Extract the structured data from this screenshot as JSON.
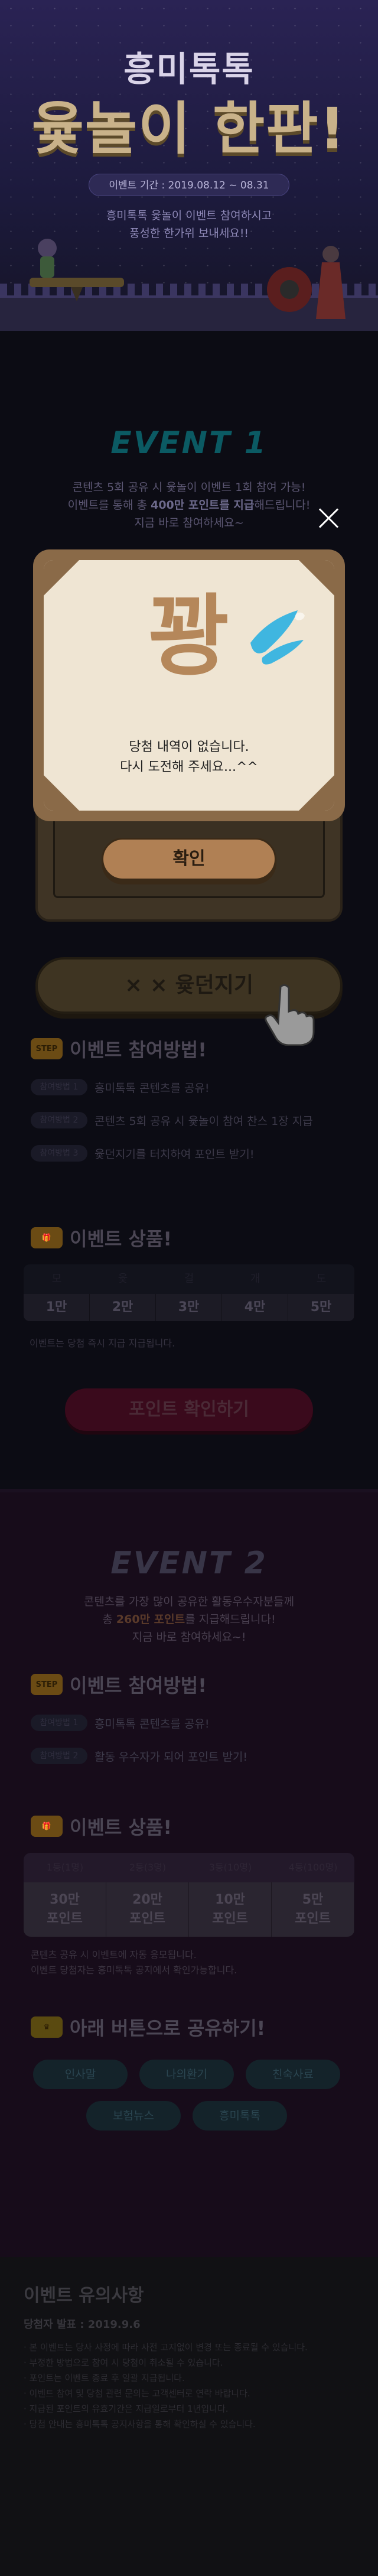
{
  "hero": {
    "title_line1": "흥미톡톡",
    "title_line2": "윷놀이 한판!",
    "period": "이벤트 기간 : 2019.08.12 ~ 08.31",
    "desc_line1": "흥미톡톡 윷놀이 이벤트 참여하시고",
    "desc_line2": "풍성한 한가위 보내세요!!"
  },
  "event1": {
    "label": "EVENT 1",
    "desc_line1": "콘텐츠 5회 공유 시 윷놀이 이벤트 1회 참여 가능!",
    "desc_line2_pre": "이벤트를 통해 총 ",
    "desc_line2_hl": "400만 포인트를 지급",
    "desc_line2_post": "해드립니다!",
    "desc_line3": "지금 바로 참여하세요~",
    "throw_button": "윷던지기",
    "throw_marks": "× ×",
    "method_title": "이벤트 참여방법!",
    "method_icon": "STEP",
    "steps": [
      {
        "badge": "참여방법 1",
        "text": "흥미톡톡 콘텐츠를 공유!"
      },
      {
        "badge": "참여방법 2",
        "text": "콘텐츠 5회 공유 시 윷놀이 참여 찬스 1장 지급"
      },
      {
        "badge": "참여방법 3",
        "text": "윷던지기를 터치하여 포인트 받기!"
      }
    ],
    "prize_title": "이벤트 상품!",
    "prize_headers": [
      "모",
      "윷",
      "걸",
      "개",
      "도"
    ],
    "prize_values": [
      "1만",
      "2만",
      "3만",
      "4만",
      "5만"
    ],
    "prize_note": "이벤트는 당첨 즉시 지급 지급됩니다.",
    "point_button": "포인트 확인하기"
  },
  "event2": {
    "label": "EVENT 2",
    "desc_line1": "콘텐츠를 가장 많이 공유한 활동우수자분들께",
    "desc_line2_pre": "총 ",
    "desc_line2_hl": "260만 포인트",
    "desc_line2_post": "를 지급해드립니다!",
    "desc_line3": "지금 바로 참여하세요~!",
    "method_title": "이벤트 참여방법!",
    "method_icon": "STEP",
    "steps": [
      {
        "badge": "참여방법 1",
        "text": "흥미톡톡 콘텐츠를 공유!"
      },
      {
        "badge": "참여방법 2",
        "text": "활동 우수자가 되어 포인트 받기!"
      }
    ],
    "prize_title": "이벤트 상품!",
    "prize_headers": [
      "1등(1명)",
      "2등(3명)",
      "3등(10명)",
      "4등(100명)"
    ],
    "prize_values": [
      "30만\n포인트",
      "20만\n포인트",
      "10만\n포인트",
      "5만\n포인트"
    ],
    "prize_note_1": "콘텐츠 공유 시 이벤트에 자동 응모됩니다.",
    "prize_note_2": "이벤트 당첨자는 흥미톡톡 공지에서 확인가능합니다.",
    "share_title": "아래 버튼으로 공유하기!",
    "share_buttons": [
      "인사말",
      "나의환기",
      "친숙사료",
      "보험뉴스",
      "흥미톡톡"
    ]
  },
  "notice": {
    "title": "이벤트 유의사항",
    "subtitle": "당첨자 발표 : 2019.9.6",
    "items": [
      "· 본 이벤트는 당사 사정에 따라 사전 고지없이 변경 또는 종료될 수 있습니다.",
      "· 부정한 방법으로 참여 시 당첨이 취소될 수 있습니다.",
      "· 포인트는 이벤트 종료 후 일괄 지급됩니다.",
      "· 이벤트 참여 및 당첨 관련 문의는 고객센터로 연락 바랍니다.",
      "· 지급된 포인트의 유효기간은 지급일로부터 1년입니다.",
      "· 당첨 안내는 흥미톡톡 공지사항을 통해 확인하실 수 있습니다."
    ]
  },
  "modal": {
    "big_text": "꽝",
    "message_line1": "당첨 내역이 없습니다.",
    "message_line2": "다시 도전해 주세요...^^",
    "confirm_label": "확인"
  },
  "colors": {
    "modal_frame": "#8a6a48",
    "modal_panel": "#efe5d3",
    "kwang_text": "#b5875a",
    "water_drops": "#3fb6e0",
    "confirm_button": "#b08054"
  },
  "icons": {
    "close": "close-icon",
    "water_drops": "water-drops-icon",
    "hand_pointer": "hand-pointer-icon",
    "crown": "crown-icon",
    "step": "step-icon",
    "gift": "gift-icon"
  }
}
